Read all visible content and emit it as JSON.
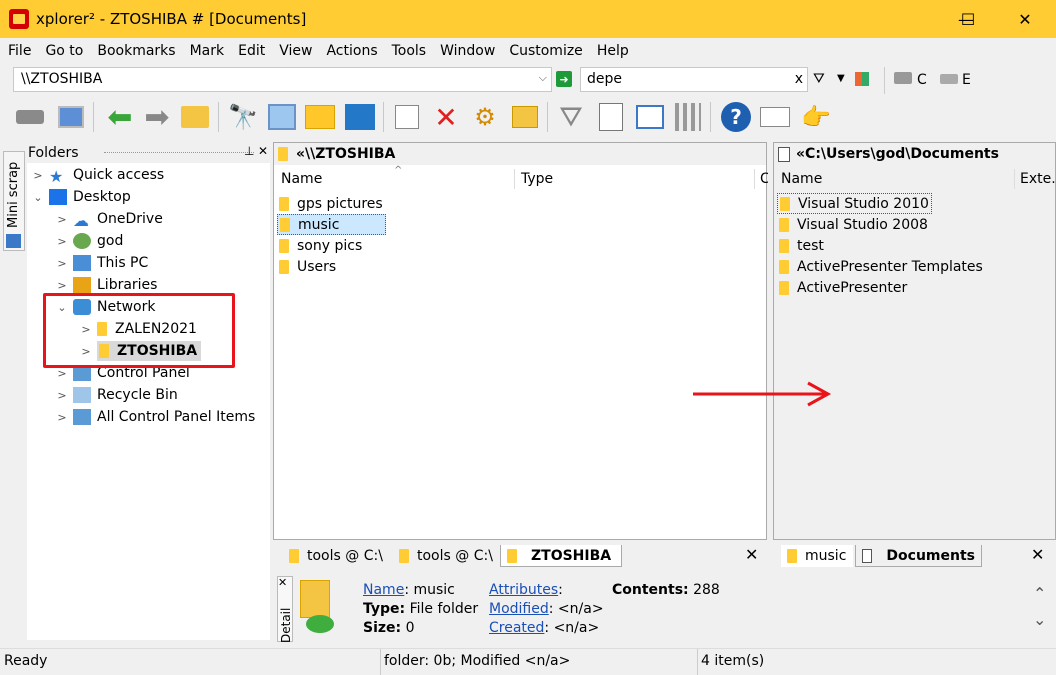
{
  "window": {
    "title": "xplorer² - ZTOSHIBA # [Documents]",
    "minimize": "—",
    "maximize": "☐",
    "close": "✕"
  },
  "menu": [
    "File",
    "Go to",
    "Bookmarks",
    "Mark",
    "Edit",
    "View",
    "Actions",
    "Tools",
    "Window",
    "Customize",
    "Help"
  ],
  "address": {
    "path": "\\\\ZTOSHIBA",
    "filter_value": "depe",
    "clear": "x",
    "drive_c": "C",
    "drive_e": "E"
  },
  "mini_scrap": "Mini scrap",
  "folders": {
    "title": "Folders",
    "pin": "⊥",
    "close": "✕",
    "items": [
      {
        "label": "Quick access",
        "icon": "star-icon"
      },
      {
        "label": "Desktop",
        "icon": "desktop-icon"
      },
      {
        "label": "OneDrive",
        "icon": "cloud-icon"
      },
      {
        "label": "god",
        "icon": "user-icon"
      },
      {
        "label": "This PC",
        "icon": "computer-icon"
      },
      {
        "label": "Libraries",
        "icon": "libraries-icon"
      },
      {
        "label": "Network",
        "icon": "network-icon"
      },
      {
        "label": "ZALEN2021",
        "icon": "folder-icon"
      },
      {
        "label": "ZTOSHIBA",
        "icon": "folder-icon"
      },
      {
        "label": "Control Panel",
        "icon": "control-panel-icon"
      },
      {
        "label": "Recycle Bin",
        "icon": "recycle-bin-icon"
      },
      {
        "label": "All Control Panel Items",
        "icon": "control-panel-icon"
      }
    ]
  },
  "left_pane": {
    "header": "«\\\\ZTOSHIBA",
    "col_name": "Name",
    "col_type": "Type",
    "col_extra": "C",
    "files": [
      "gps pictures",
      "music",
      "sony pics",
      "Users"
    ],
    "tabs": [
      "tools @ C:\\",
      "tools @ C:\\",
      "ZTOSHIBA"
    ]
  },
  "right_pane": {
    "header": "«C:\\Users\\god\\Documents",
    "col_name": "Name",
    "col_ext": "Exte.",
    "files": [
      "Visual Studio 2010",
      "Visual Studio 2008",
      "test",
      "ActivePresenter Templates",
      "ActivePresenter"
    ],
    "tabs": [
      "music",
      "Documents"
    ]
  },
  "details": {
    "tab_label": "Detail",
    "name_label": "Name",
    "name_value": ": music",
    "type_label": "Type:",
    "type_value": "File folder",
    "size_label": "Size:",
    "size_value": "0",
    "attributes_label": "Attributes",
    "attributes_colon": ":",
    "modified_label": "Modified",
    "modified_value": ": <n/a>",
    "created_label": "Created",
    "created_value": ": <n/a>",
    "contents_label": "Contents:",
    "contents_value": "288"
  },
  "status": {
    "left": "Ready",
    "mid": "folder: 0b; Modified <n/a>",
    "right": "4 item(s)"
  },
  "colors": {
    "title_bar": "#ffcc33",
    "highlight_box": "#e8141a",
    "arrow": "#e8141a",
    "link": "#1a4fb5",
    "selection": "#cce8ff"
  }
}
